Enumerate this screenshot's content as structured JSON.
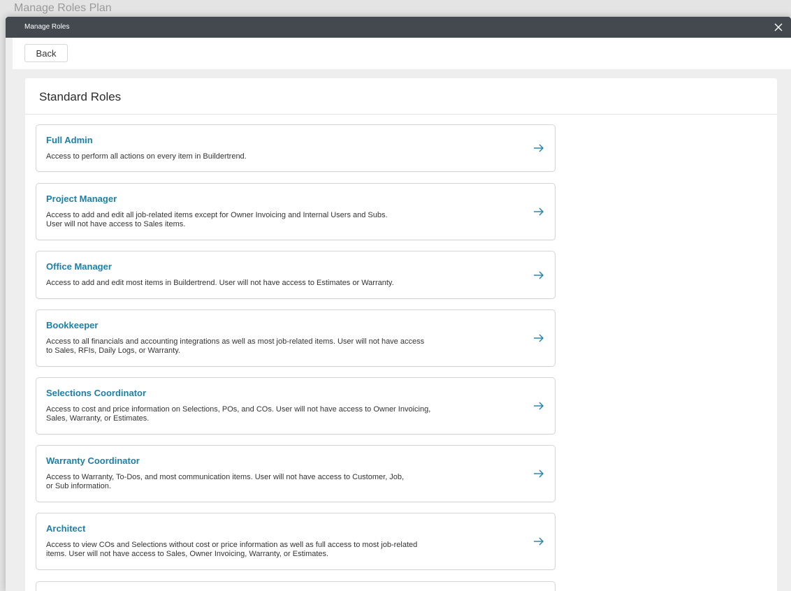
{
  "backdrop": {
    "title": "Manage Roles Plan"
  },
  "modal": {
    "title": "Manage Roles",
    "close_icon": "close-icon"
  },
  "toolbar": {
    "back_label": "Back"
  },
  "panel": {
    "title": "Standard Roles"
  },
  "roles": [
    {
      "name": "Full Admin",
      "description": "Access to perform all actions on every item in Buildertrend."
    },
    {
      "name": "Project Manager",
      "description": "Access to add and edit all job-related items except for Owner Invoicing and Internal Users and Subs.\nUser will not have access to Sales items."
    },
    {
      "name": "Office Manager",
      "description": "Access to add and edit most items in Buildertrend. User will not have access to Estimates or Warranty."
    },
    {
      "name": "Bookkeeper",
      "description": "Access to all financials and accounting integrations as well as most job-related items. User will not have access\nto Sales, RFIs, Daily Logs, or Warranty."
    },
    {
      "name": "Selections Coordinator",
      "description": "Access to cost and price information on Selections, POs, and COs. User will not have access to Owner Invoicing,\nSales, Warranty, or Estimates."
    },
    {
      "name": "Warranty Coordinator",
      "description": "Access to Warranty, To-Dos, and most communication items. User will not have access to Customer, Job,\nor Sub information."
    },
    {
      "name": "Architect",
      "description": "Access to view COs and Selections without cost or price information as well as full access to most job-related\nitems. User will not have access to Sales, Owner Invoicing, Warranty, or Estimates."
    }
  ],
  "colors": {
    "header_bg": "#43494f",
    "role_link": "#1c7fa8",
    "arrow": "#1c7fa8"
  }
}
